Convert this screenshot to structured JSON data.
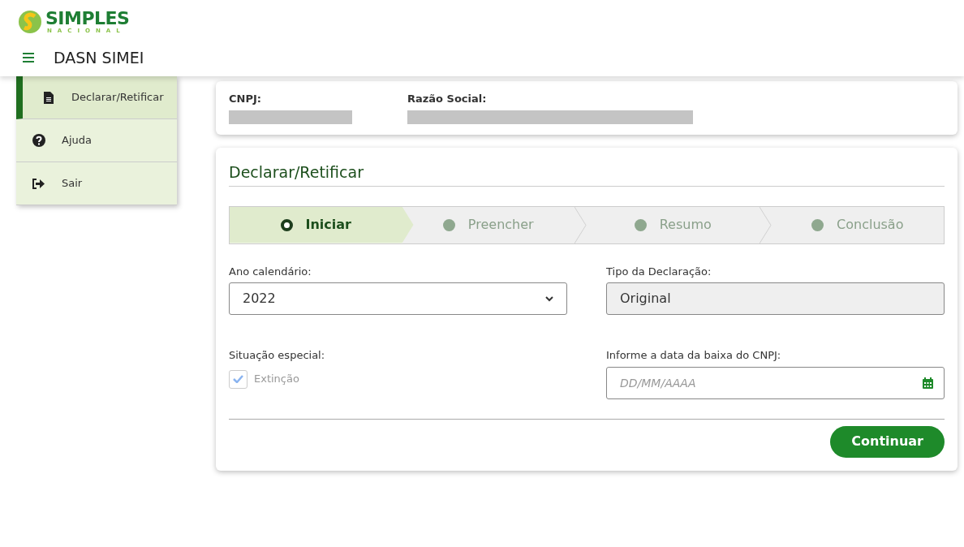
{
  "logo": {
    "title": "SIMPLES",
    "subtitle": "NACIONAL"
  },
  "app_title": "DASN SIMEI",
  "sidebar": {
    "items": [
      {
        "label": "Declarar/Retificar",
        "selected": true
      },
      {
        "label": "Ajuda",
        "selected": false
      },
      {
        "label": "Sair",
        "selected": false
      }
    ]
  },
  "identification": {
    "fields": [
      {
        "label": "CNPJ:"
      },
      {
        "label": "Razão Social:"
      }
    ]
  },
  "form": {
    "title": "Declarar/Retificar",
    "steps": [
      {
        "label": "Iniciar",
        "selected": true
      },
      {
        "label": "Preencher",
        "selected": false
      },
      {
        "label": "Resumo",
        "selected": false
      },
      {
        "label": "Conclusão",
        "selected": false
      }
    ],
    "ano": {
      "label": "Ano calendário:",
      "value": "2022"
    },
    "tipo": {
      "label": "Tipo da Declaração:",
      "value": "Original",
      "disabled": true
    },
    "situacao": {
      "label": "Situação especial:",
      "option": "Extinção",
      "checked": true,
      "disabled": true
    },
    "data_baixa": {
      "label": "Informe a data da baixa do CNPJ:",
      "placeholder": "DD/MM/AAAA"
    },
    "button": "Continuar"
  }
}
